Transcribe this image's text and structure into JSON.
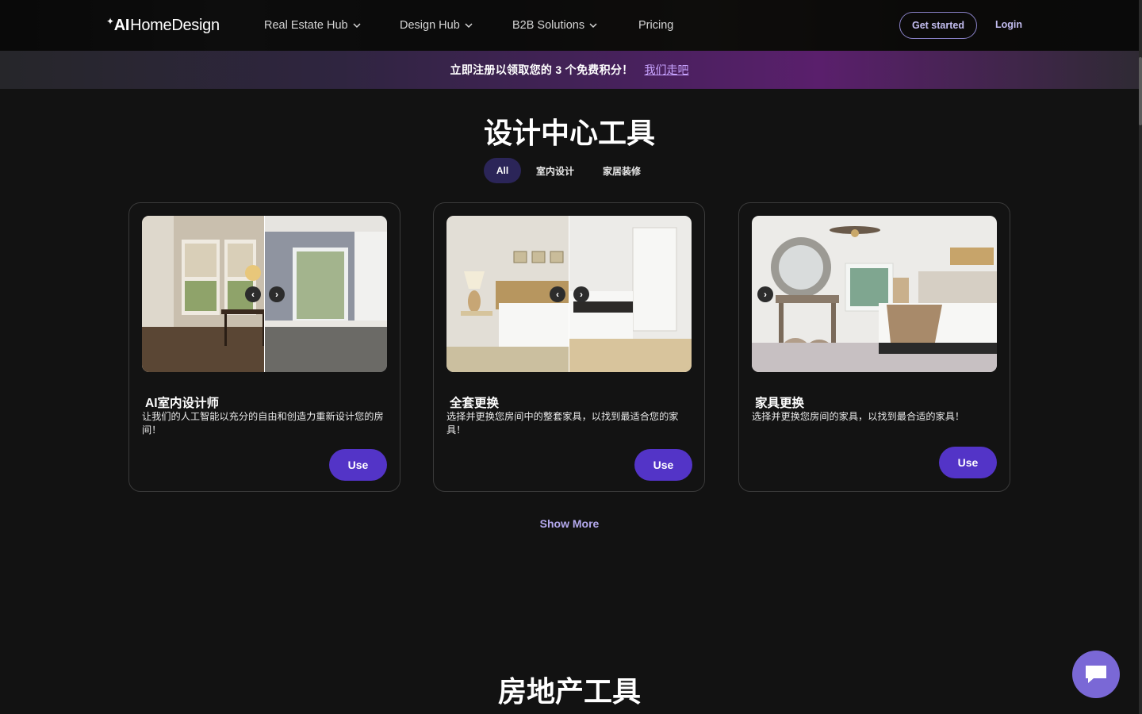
{
  "nav": {
    "logo_spark": "✦",
    "logo_ai": "AI",
    "logo_text": "HomeDesign",
    "items": [
      {
        "label": "Real Estate Hub"
      },
      {
        "label": "Design Hub"
      },
      {
        "label": "B2B Solutions"
      },
      {
        "label": "Pricing"
      }
    ],
    "get_started": "Get started",
    "login": "Login"
  },
  "banner": {
    "text": "立即注册以领取您的 3 个免费积分！",
    "link": "我们走吧"
  },
  "design_section": {
    "title": "设计中心工具",
    "filters": [
      "All",
      "室内设计",
      "家居装修"
    ],
    "active_filter": "All"
  },
  "cards": [
    {
      "title": "AI室内设计师",
      "description": "让我们的人工智能以充分的自由和创造力重新设计您的房间！",
      "button": "Use"
    },
    {
      "title": "全套更换",
      "description": "选择并更换您房间中的整套家具，以找到最适合您的家具！",
      "button": "Use"
    },
    {
      "title": "家具更换",
      "description": "选择并更换您房间的家具，以找到最合适的家具！",
      "button": "Use"
    }
  ],
  "show_more": "Show More",
  "real_estate_section": {
    "title": "房地产工具"
  },
  "icons": {
    "chevron": "chevron-down-icon",
    "prev": "‹",
    "next": "›",
    "chat": "chat-bubble-icon"
  },
  "colors": {
    "accent": "#5334c7",
    "accent_light": "#b4a9ee",
    "background": "#121212",
    "banner_purple": "#5a1f6c"
  }
}
